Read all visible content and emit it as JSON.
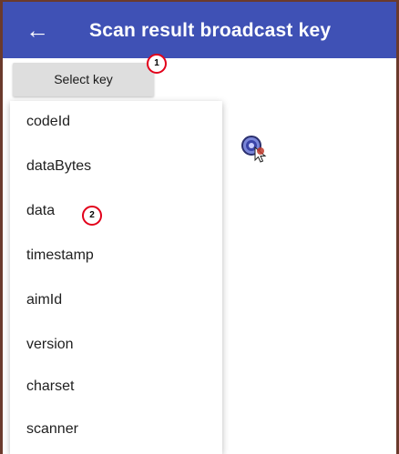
{
  "appbar": {
    "back_icon": "arrow-left-icon",
    "title": "Scan result broadcast key"
  },
  "select_key": {
    "label": "Select key"
  },
  "badges": [
    {
      "label": "1"
    },
    {
      "label": "2"
    }
  ],
  "menu": {
    "items": [
      {
        "label": "codeId"
      },
      {
        "label": "dataBytes"
      },
      {
        "label": "data"
      },
      {
        "label": "timestamp"
      },
      {
        "label": "aimId"
      },
      {
        "label": "version"
      },
      {
        "label": "charset"
      },
      {
        "label": "scanner"
      }
    ]
  },
  "colors": {
    "appbar": "#3f51b5",
    "badge_ring": "#e2001a",
    "button_bg": "#dedede"
  }
}
